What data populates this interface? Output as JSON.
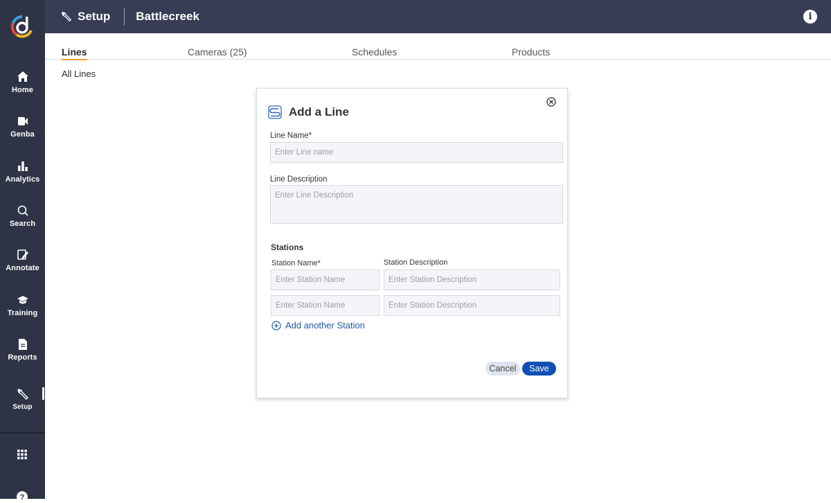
{
  "sidebar": {
    "items": [
      {
        "label": "Home",
        "icon": "home-icon"
      },
      {
        "label": "Genba",
        "icon": "video-camera-icon"
      },
      {
        "label": "Analytics",
        "icon": "bar-chart-icon"
      },
      {
        "label": "Search",
        "icon": "search-icon"
      },
      {
        "label": "Annotate",
        "icon": "annotate-icon"
      },
      {
        "label": "Training",
        "icon": "graduation-cap-icon"
      },
      {
        "label": "Reports",
        "icon": "document-icon"
      },
      {
        "label": "Setup",
        "icon": "wrench-icon"
      }
    ],
    "active": "Setup"
  },
  "header": {
    "title": "Setup",
    "site": "Battlecreek"
  },
  "tabs": [
    {
      "label": "Lines",
      "active": true
    },
    {
      "label": "Cameras (25)",
      "active": false
    },
    {
      "label": "Schedules",
      "active": false
    },
    {
      "label": "Products",
      "active": false
    }
  ],
  "breadcrumb": "All Lines",
  "modal": {
    "title": "Add a Line",
    "line_name_label": "Line Name*",
    "line_name_placeholder": "Enter Line name",
    "line_desc_label": "Line Description",
    "line_desc_placeholder": "Enter Line Description",
    "stations_heading": "Stations",
    "station_name_label": "Station Name*",
    "station_desc_label": "Station Description",
    "station_name_placeholder": "Enter Station Name",
    "station_desc_placeholder": "Enter Station Description",
    "add_station_label": "Add another Station",
    "cancel_label": "Cancel",
    "save_label": "Save"
  },
  "colors": {
    "sidebar_bg": "#2e3446",
    "header_bg": "#363d55",
    "active_tab_underline": "#f0a030",
    "primary_button": "#1050b3",
    "link": "#1d5aa6"
  }
}
